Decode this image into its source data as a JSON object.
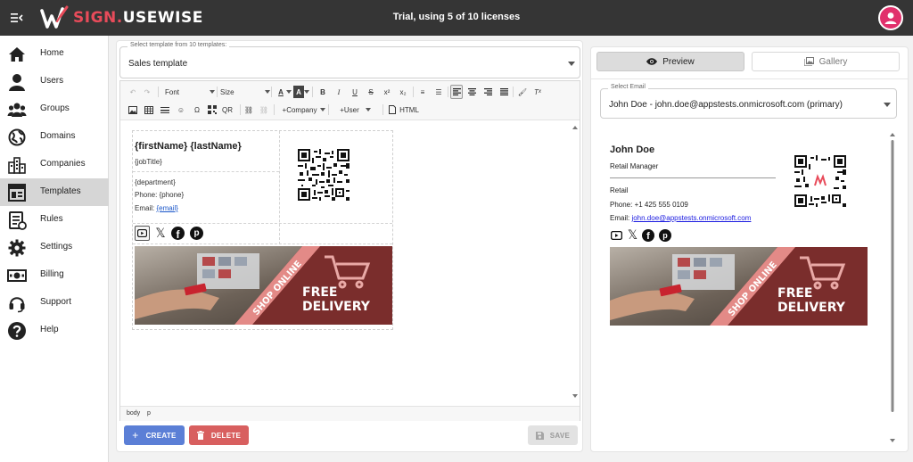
{
  "app": {
    "brand_part1": "SIGN.",
    "brand_part2": "USEWISE",
    "trial_text": "Trial, using 5 of 10 licenses",
    "accent_color": "#e84b5a",
    "topbar_color": "#353535"
  },
  "sidebar": {
    "items": [
      {
        "label": "Home",
        "icon": "home-icon"
      },
      {
        "label": "Users",
        "icon": "user-icon"
      },
      {
        "label": "Groups",
        "icon": "groups-icon"
      },
      {
        "label": "Domains",
        "icon": "globe-icon"
      },
      {
        "label": "Companies",
        "icon": "buildings-icon"
      },
      {
        "label": "Templates",
        "icon": "template-icon",
        "active": true
      },
      {
        "label": "Rules",
        "icon": "rules-icon"
      },
      {
        "label": "Settings",
        "icon": "gear-icon"
      },
      {
        "label": "Billing",
        "icon": "money-icon"
      },
      {
        "label": "Support",
        "icon": "headset-icon"
      },
      {
        "label": "Help",
        "icon": "help-icon"
      }
    ]
  },
  "editor": {
    "template_legend": "Select template from 10 templates:",
    "template_value": "Sales template",
    "toolbar": {
      "font": "Font",
      "size": "Size",
      "qr": "QR",
      "company": "+Company",
      "user": "+User",
      "html": "HTML"
    },
    "signature": {
      "name": "{firstName} {lastName}",
      "job_title": "{jobTitle}",
      "department": "{department}",
      "phone_label": "Phone: ",
      "phone": "{phone}",
      "email_label": "Email: ",
      "email": "{email}"
    },
    "banner": {
      "ribbon": "SHOP ONLINE",
      "line1": "FREE",
      "line2": "DELIVERY"
    },
    "statusbar": {
      "path1": "body",
      "path2": "p"
    },
    "buttons": {
      "create": "CREATE",
      "delete": "DELETE",
      "save": "SAVE"
    }
  },
  "preview": {
    "tab_preview": "Preview",
    "tab_gallery": "Gallery",
    "email_legend": "Select Email",
    "email_value": "John Doe - john.doe@appstests.onmicrosoft.com (primary)",
    "signature": {
      "name": "John Doe",
      "job_title": "Retail Manager",
      "department": "Retail",
      "phone_line": "Phone: +1 425 555 0109",
      "email_label": "Email: ",
      "email": "john.doe@appstests.onmicrosoft.com"
    }
  }
}
